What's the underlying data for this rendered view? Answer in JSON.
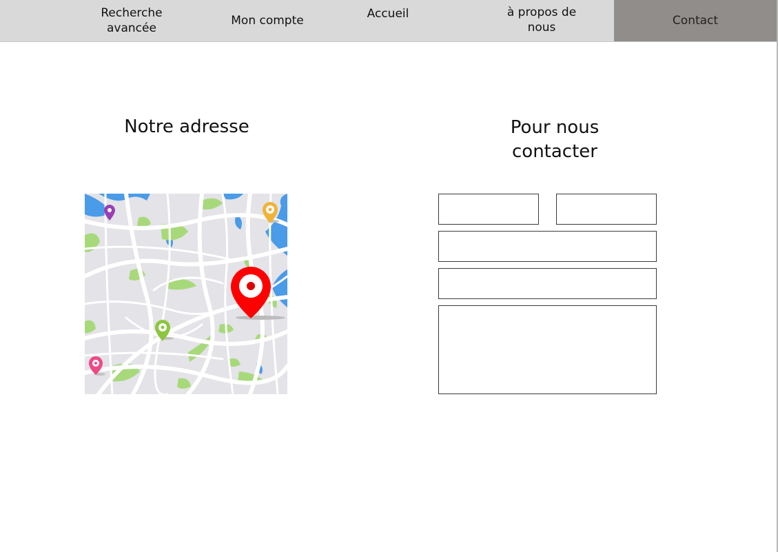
{
  "nav": {
    "items": [
      {
        "label": "Recherche\navancée",
        "active": false
      },
      {
        "label": "Mon compte",
        "active": false
      },
      {
        "label": "Accueil",
        "active": false
      },
      {
        "label": "à propos de\nnous",
        "active": false
      },
      {
        "label": "Contact",
        "active": true
      }
    ]
  },
  "address_section": {
    "title": "Notre adresse",
    "map": {
      "icon": "map-illustration",
      "pins": [
        {
          "name": "purple-pin-icon",
          "color": "#9b3fb5"
        },
        {
          "name": "yellow-pin-icon",
          "color": "#f0b33a"
        },
        {
          "name": "red-main-pin-icon",
          "color": "#ff0000"
        },
        {
          "name": "green-pin-icon",
          "color": "#8cc63f"
        },
        {
          "name": "pink-pin-icon",
          "color": "#ee4a86"
        }
      ]
    }
  },
  "contact_section": {
    "title": "Pour nous\ncontacter",
    "fields": {
      "first_name": {
        "value": "",
        "placeholder": ""
      },
      "last_name": {
        "value": "",
        "placeholder": ""
      },
      "email": {
        "value": "",
        "placeholder": ""
      },
      "subject": {
        "value": "",
        "placeholder": ""
      },
      "message": {
        "value": "",
        "placeholder": ""
      }
    }
  },
  "colors": {
    "nav_bg": "#d9d9d9",
    "nav_active_bg": "#918d8b",
    "map_water": "#4a9be8",
    "map_park": "#a7d97a",
    "map_block": "#e3e3e8"
  }
}
